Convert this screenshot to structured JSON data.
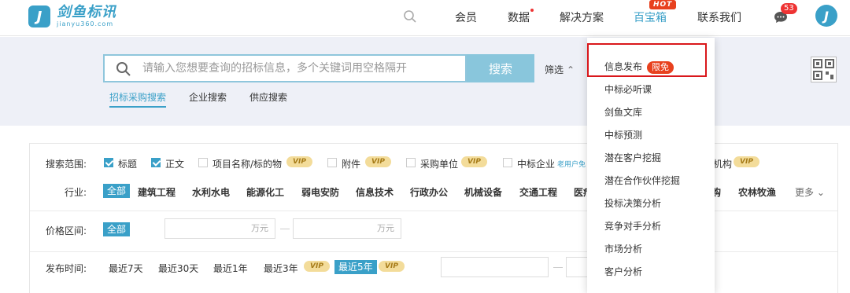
{
  "header": {
    "logo_name": "剑鱼标讯",
    "logo_url": "jianyu360.com",
    "nav": [
      "会员",
      "数据",
      "解决方案",
      "百宝箱",
      "联系我们"
    ],
    "hot_badge": "HOT",
    "notification_count": "53"
  },
  "search": {
    "placeholder": "请输入您想要查询的招标信息，多个关键词用空格隔开",
    "button": "搜索",
    "filter_label": "筛选",
    "tabs": [
      "招标采购搜索",
      "企业搜索",
      "供应搜索"
    ]
  },
  "filters": {
    "scope_label": "搜索范围:",
    "scope_options": [
      {
        "label": "标题",
        "checked": true
      },
      {
        "label": "正文",
        "checked": true
      },
      {
        "label": "项目名称/标的物",
        "checked": false,
        "vip": true
      },
      {
        "label": "附件",
        "checked": false,
        "vip": true
      },
      {
        "label": "采购单位",
        "checked": false,
        "vip": true
      },
      {
        "label": "中标企业",
        "checked": false
      }
    ],
    "scope_hint": "老用户免",
    "scope_tail": "机构",
    "vip_label": "VIP",
    "industry_label": "行业:",
    "industry_active": "全部",
    "industries": [
      "建筑工程",
      "水利水电",
      "能源化工",
      "弱电安防",
      "信息技术",
      "行政办公",
      "机械设备",
      "交通工程",
      "医疗"
    ],
    "industry_tail": [
      "购",
      "农林牧渔"
    ],
    "more": "更多",
    "price_label": "价格区间:",
    "price_active": "全部",
    "price_unit": "万元",
    "time_label": "发布时间:",
    "time_options": [
      "最近7天",
      "最近30天",
      "最近1年",
      "最近3年",
      "最近5年"
    ],
    "time_active": "最近5年"
  },
  "dropdown": {
    "items": [
      "信息发布",
      "中标必听课",
      "剑鱼文库",
      "中标预测",
      "潜在客户挖掘",
      "潜在合作伙伴挖掘",
      "投标决策分析",
      "竞争对手分析",
      "市场分析",
      "客户分析"
    ],
    "limited_label": "限免"
  },
  "colors": {
    "brand": "#3aa0c8",
    "search_button": "#89c6dc",
    "hot": "#e8411e",
    "vip_bg": "#f3dc9a",
    "highlight_border": "#d9171b"
  }
}
